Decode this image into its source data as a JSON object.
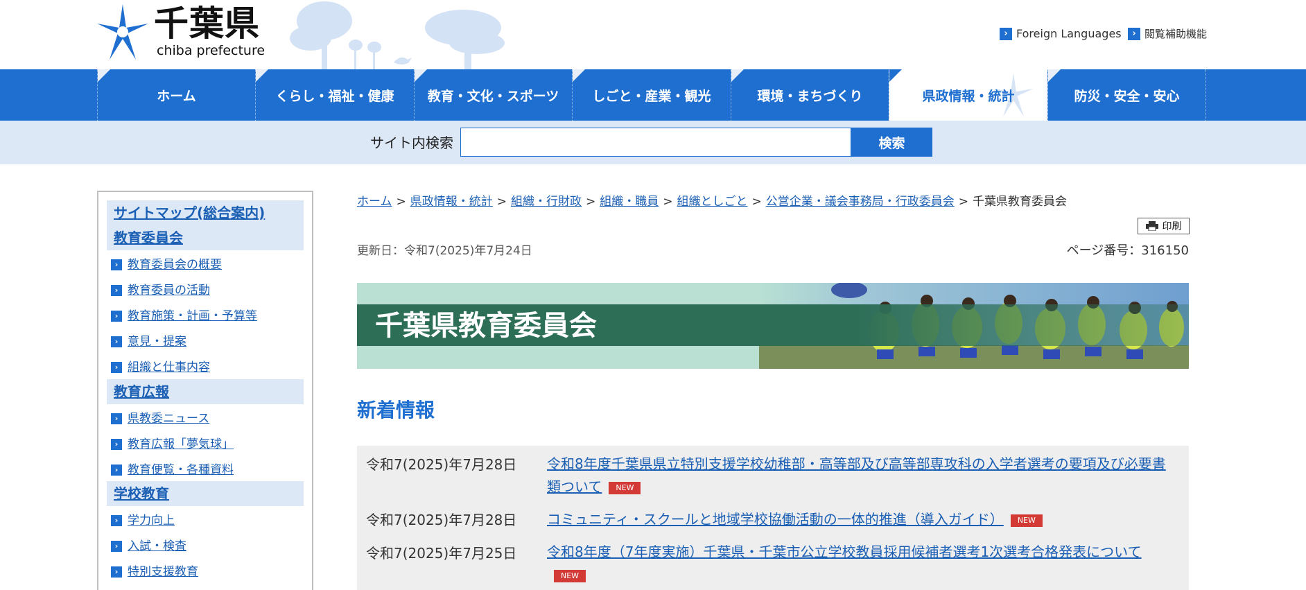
{
  "site": {
    "logo_kanji": "千葉県",
    "logo_roman": "chiba prefecture"
  },
  "utility_links": [
    {
      "label": "Foreign Languages"
    },
    {
      "label": "閲覧補助機能"
    }
  ],
  "global_nav": [
    {
      "label": "ホーム",
      "active": false
    },
    {
      "label": "くらし・福祉・健康",
      "active": false
    },
    {
      "label": "教育・文化・スポーツ",
      "active": false
    },
    {
      "label": "しごと・産業・観光",
      "active": false
    },
    {
      "label": "環境・まちづくり",
      "active": false
    },
    {
      "label": "県政情報・統計",
      "active": true
    },
    {
      "label": "防災・安全・安心",
      "active": false
    }
  ],
  "search": {
    "label": "サイト内検索",
    "value": "",
    "button_label": "検索"
  },
  "sidebar": {
    "sections": [
      {
        "heading": "サイトマップ(総合案内)",
        "heading2": "教育委員会",
        "items": [
          "教育委員会の概要",
          "教育委員の活動",
          "教育施策・計画・予算等",
          "意見・提案",
          "組織と仕事内容"
        ]
      },
      {
        "heading": "教育広報",
        "items": [
          "県教委ニュース",
          "教育広報「夢気球」",
          "教育便覧・各種資料"
        ]
      },
      {
        "heading": "学校教育",
        "items": [
          "学力向上",
          "入試・検査",
          "特別支援教育"
        ]
      }
    ]
  },
  "breadcrumb": {
    "links": [
      "ホーム",
      "県政情報・統計",
      "組織・行財政",
      "組織・職員",
      "組織としごと",
      "公営企業・議会事務局・行政委員会"
    ],
    "current": "千葉県教育委員会",
    "separator": ">"
  },
  "print_label": "印刷",
  "updated": "更新日：令和7(2025)年7月24日",
  "page_number": "ページ番号：316150",
  "banner_title": "千葉県教育委員会",
  "news": {
    "heading": "新着情報",
    "new_label": "NEW",
    "items": [
      {
        "date": "令和7(2025)年7月28日",
        "title": "令和8年度千葉県県立特別支援学校幼稚部・高等部及び高等部専攻科の入学者選考の要項及び必要書類ついて"
      },
      {
        "date": "令和7(2025)年7月28日",
        "title": "コミュニティ・スクールと地域学校協働活動の一体的推進（導入ガイド）"
      },
      {
        "date": "令和7(2025)年7月25日",
        "title": "令和8年度（7年度実施）千葉県・千葉市公立学校教員採用候補者選考1次選考合格発表について"
      }
    ]
  },
  "colors": {
    "brand_blue": "#1f6fd1",
    "search_band": "#dde8f7",
    "banner_green": "#2d6e57",
    "new_badge": "#d33a36"
  }
}
